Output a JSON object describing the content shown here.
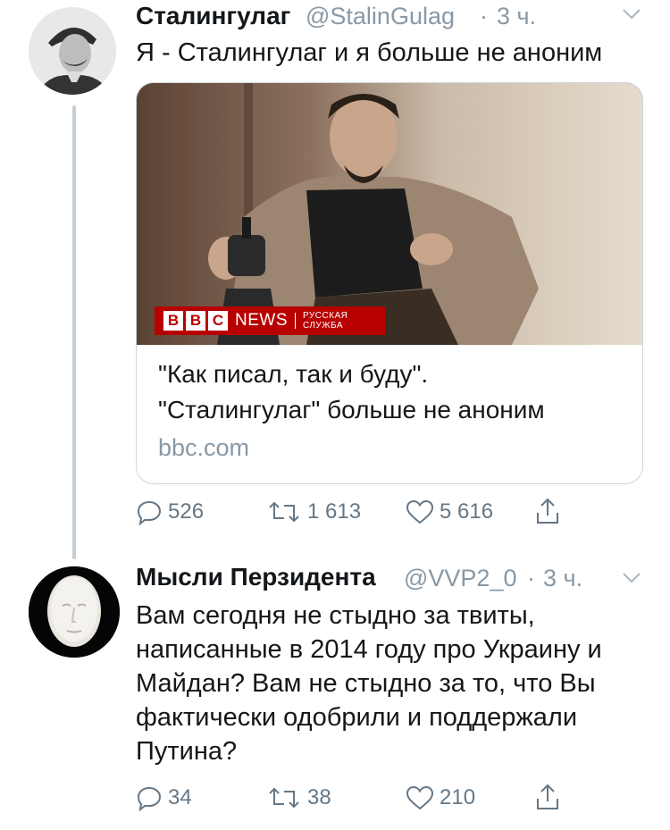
{
  "tweet1": {
    "display_name": "Сталингулаг",
    "handle": "@StalinGulag",
    "separator": "·",
    "time": "3 ч.",
    "text": "Я - Сталингулаг и я больше не аноним",
    "card": {
      "title_line1": "\"Как писал, так и буду\".",
      "title_line2": "\"Сталингулаг\" больше не аноним",
      "domain": "bbc.com",
      "brand": {
        "b1": "B",
        "b2": "B",
        "b3": "C",
        "news": "NEWS",
        "service": "РУССКАЯ СЛУЖБА"
      }
    },
    "actions": {
      "replies": "526",
      "retweets": "1 613",
      "likes": "5 616"
    }
  },
  "tweet2": {
    "display_name": "Мысли Перзидента",
    "handle": "@VVP2_0",
    "separator": "·",
    "time": "3 ч.",
    "text_lines": [
      "Вам сегодня не стыдно за твиты,",
      "написанные в 2014 году про Украину и",
      "Майдан? Вам не стыдно за то, что Вы",
      "фактически одобрили и поддержали",
      "Путина?"
    ],
    "actions": {
      "replies": "34",
      "retweets": "38",
      "likes": "210"
    }
  },
  "colors": {
    "text": "#14171a",
    "secondary": "#8899a6",
    "icon": "#657786",
    "thread": "#c4cfd6",
    "bbc_red": "#b80000"
  },
  "icons": [
    "chevron-down-icon",
    "reply-icon",
    "retweet-icon",
    "like-icon",
    "share-icon"
  ]
}
